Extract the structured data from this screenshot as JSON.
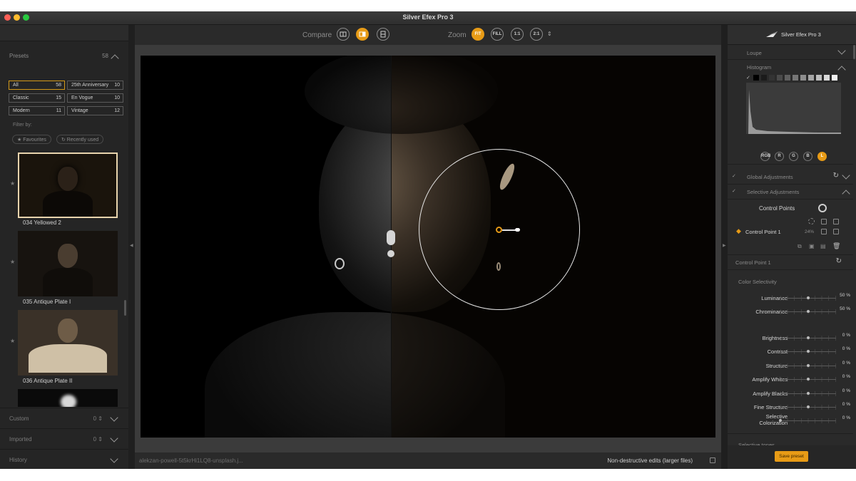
{
  "window": {
    "title": "Silver Efex Pro 3"
  },
  "left_panel": {
    "presets_label": "Presets",
    "presets_count": "58",
    "categories": [
      {
        "name": "All",
        "count": "58",
        "selected": true
      },
      {
        "name": "25th Anniversary",
        "count": "10"
      },
      {
        "name": "Classic",
        "count": "15"
      },
      {
        "name": "En Vogue",
        "count": "10"
      },
      {
        "name": "Modern",
        "count": "11"
      },
      {
        "name": "Vintage",
        "count": "12"
      }
    ],
    "filter_by": "Filter by:",
    "filters": [
      "★ Favourites",
      "↻ Recently used"
    ],
    "thumbnails": [
      {
        "label": "034 Yellowed 2"
      },
      {
        "label": "035 Antique Plate I"
      },
      {
        "label": "036 Antique Plate II"
      }
    ],
    "bottom_sections": [
      {
        "label": "Custom",
        "count": "0 ⇕"
      },
      {
        "label": "Imported",
        "count": "0 ⇕"
      },
      {
        "label": "History",
        "count": ""
      }
    ]
  },
  "toolbar": {
    "compare_label": "Compare",
    "zoom_label": "Zoom",
    "zoom_options": [
      "FIT",
      "FILL",
      "1:1",
      "2:1"
    ],
    "zoom_selected": "FIT"
  },
  "status_bar": {
    "filename": "alekzan-powell-5t5krHi1LQ8-unsplash.j...",
    "nondestructive": "Non-destructive edits (larger files)"
  },
  "right_panel": {
    "brand": "Silver Efex Pro 3",
    "loupe": "Loupe",
    "histogram": "Histogram",
    "channels": [
      "RGB",
      "R",
      "G",
      "B",
      "L"
    ],
    "channel_selected": "L",
    "global_adjustments": "Global Adjustments",
    "selective_adjustments": "Selective Adjustments",
    "control_points_label": "Control Points",
    "control_point": {
      "name": "Control Point 1",
      "percent": "24%"
    },
    "control_point_title": "Control Point 1",
    "color_selectivity": "Color Selectivity",
    "selectivity_sliders": [
      {
        "label": "Luminance",
        "value": "50 %",
        "pos": 0.5
      },
      {
        "label": "Chrominance",
        "value": "50 %",
        "pos": 0.5
      }
    ],
    "adjust_sliders": [
      {
        "label": "Brightness",
        "value": "0 %",
        "pos": 0.5
      },
      {
        "label": "Contrast",
        "value": "0 %",
        "pos": 0.5
      },
      {
        "label": "Structure",
        "value": "0 %",
        "pos": 0.5
      },
      {
        "label": "Amplify Whites",
        "value": "0 %",
        "pos": 0.5
      },
      {
        "label": "Amplify Blacks",
        "value": "0 %",
        "pos": 0.5
      },
      {
        "label": "Fine Structure",
        "value": "0 %",
        "pos": 0.5
      },
      {
        "label": "Selective Colorization",
        "value": "0 %",
        "pos": 0.0
      }
    ],
    "selective_tones": "Selective tones",
    "save_preset": "Save preset"
  },
  "colors": {
    "accent": "#e79b16",
    "panel": "#262626",
    "canvas": "#3b3b3b"
  }
}
